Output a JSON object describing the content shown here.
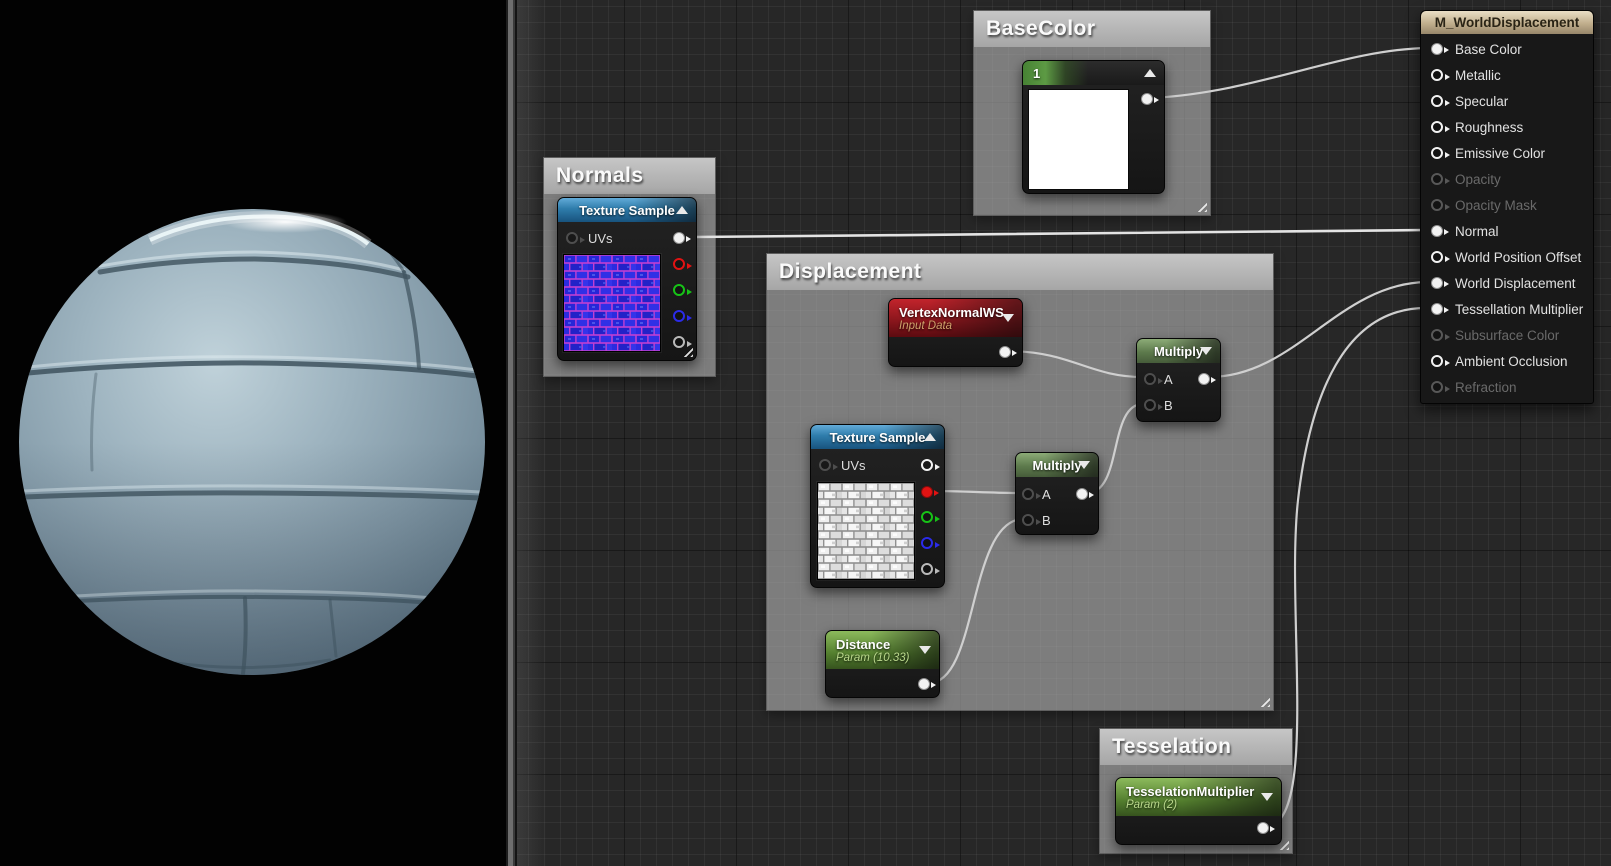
{
  "comments": {
    "basecolor": "BaseColor",
    "normals": "Normals",
    "displacement": "Displacement",
    "tesselation": "Tesselation"
  },
  "nodes": {
    "const_one": {
      "value": "1"
    },
    "normals_sample": {
      "title": "Texture Sample",
      "uvs_label": "UVs"
    },
    "displacement_sample": {
      "title": "Texture Sample",
      "uvs_label": "UVs"
    },
    "vertex_normal": {
      "title": "VertexNormalWS",
      "subtitle": "Input Data"
    },
    "multiply_top": {
      "title": "Multiply",
      "a": "A",
      "b": "B"
    },
    "multiply_bottom": {
      "title": "Multiply",
      "a": "A",
      "b": "B"
    },
    "distance": {
      "title": "Distance",
      "subtitle": "Param (10.33)"
    },
    "tess_multiplier": {
      "title": "TesselationMultiplier",
      "subtitle": "Param (2)"
    }
  },
  "material": {
    "title": "M_WorldDisplacement",
    "pins": [
      {
        "label": "Base Color",
        "state": "connected"
      },
      {
        "label": "Metallic",
        "state": "open"
      },
      {
        "label": "Specular",
        "state": "open"
      },
      {
        "label": "Roughness",
        "state": "open"
      },
      {
        "label": "Emissive Color",
        "state": "open"
      },
      {
        "label": "Opacity",
        "state": "disabled"
      },
      {
        "label": "Opacity Mask",
        "state": "disabled"
      },
      {
        "label": "Normal",
        "state": "connected"
      },
      {
        "label": "World Position Offset",
        "state": "open"
      },
      {
        "label": "World Displacement",
        "state": "connected"
      },
      {
        "label": "Tessellation Multiplier",
        "state": "connected"
      },
      {
        "label": "Subsurface Color",
        "state": "disabled"
      },
      {
        "label": "Ambient Occlusion",
        "state": "open"
      },
      {
        "label": "Refraction",
        "state": "disabled"
      }
    ]
  },
  "colors": {
    "graph_background": "#272727",
    "texture_sample_header": "#2e7cab",
    "multiply_header": "#5d7a4c",
    "input_data_header": "#9e1b22",
    "param_header": "#537e2e",
    "material_header": "#c0ae8c",
    "wire": "#cfcfcf",
    "sphere": "#8fa7b5"
  }
}
